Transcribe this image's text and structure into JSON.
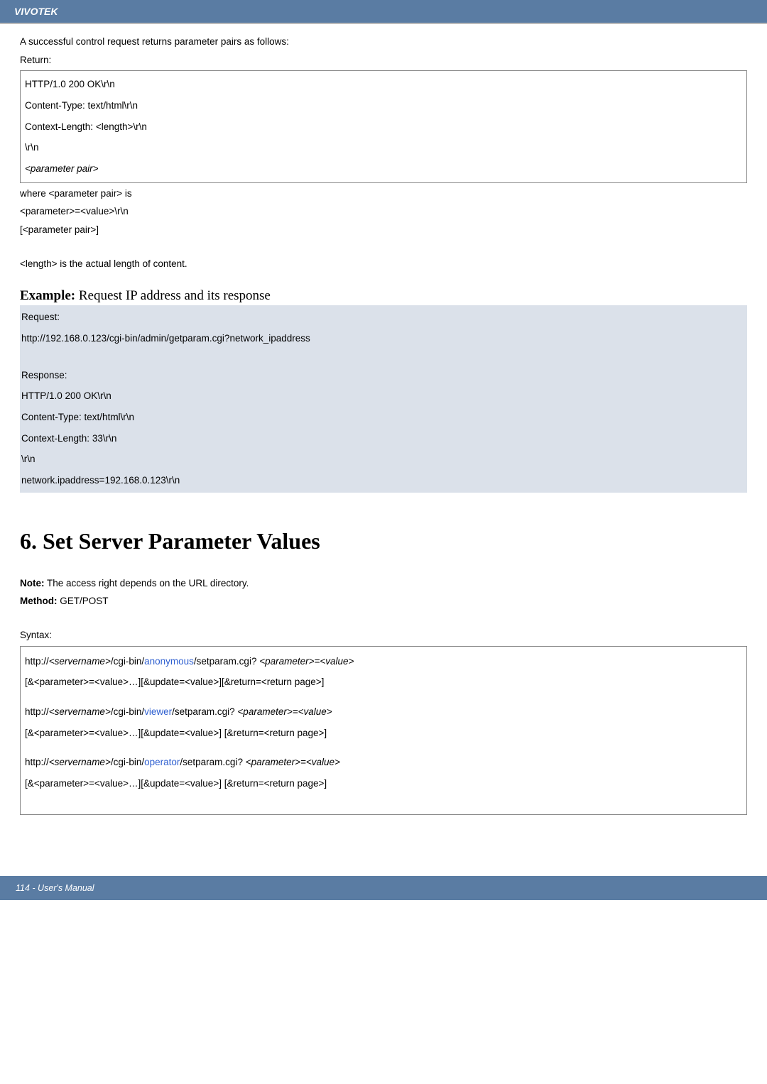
{
  "header": {
    "brand": "VIVOTEK"
  },
  "intro": {
    "line1": "A successful control request returns parameter pairs as follows:",
    "return_label": "Return:"
  },
  "return_box": {
    "l1": "HTTP/1.0 200 OK\\r\\n",
    "l2": "Content-Type: text/html\\r\\n",
    "l3": "Context-Length: <length>\\r\\n",
    "l4": "\\r\\n",
    "l5": "<parameter pair>"
  },
  "where": {
    "l1": "where <parameter pair> is",
    "l2": "<parameter>=<value>\\r\\n",
    "l3": "[<parameter pair>]",
    "l4": "<length> is the actual length of content."
  },
  "example": {
    "hdr_bold": "Example:",
    "hdr_rest": " Request IP address and its response",
    "req_label": "Request:",
    "req_url": "http://192.168.0.123/cgi-bin/admin/getparam.cgi?network_ipaddress",
    "resp_label": "Response:",
    "r1": "HTTP/1.0 200 OK\\r\\n",
    "r2": "Content-Type: text/html\\r\\n",
    "r3": "Context-Length: 33\\r\\n",
    "r4": "\\r\\n",
    "r5": "network.ipaddress=192.168.0.123\\r\\n"
  },
  "section6": {
    "title": "6. Set Server Parameter Values",
    "note_label": "Note:",
    "note_text": " The access right depends on the URL directory.",
    "method_label": "Method:",
    "method_text": " GET/POST",
    "syntax_label": "Syntax:"
  },
  "syntax": {
    "a1_pre": "http://",
    "a1_srv": "<servername>",
    "a1_mid": "/cgi-bin/",
    "a1_role": "anonymous",
    "a1_post": "/setparam.cgi? ",
    "a1_param": "<parameter>=<value>",
    "a2": "[&<parameter>=<value>…][&update=<value>][&return=<return page>]",
    "b1_role": "viewer",
    "b2": "[&<parameter>=<value>…][&update=<value>] [&return=<return page>]",
    "c1_role": "operator",
    "c2": "[&<parameter>=<value>…][&update=<value>] [&return=<return page>]"
  },
  "footer": {
    "text": "114 - User's Manual"
  }
}
